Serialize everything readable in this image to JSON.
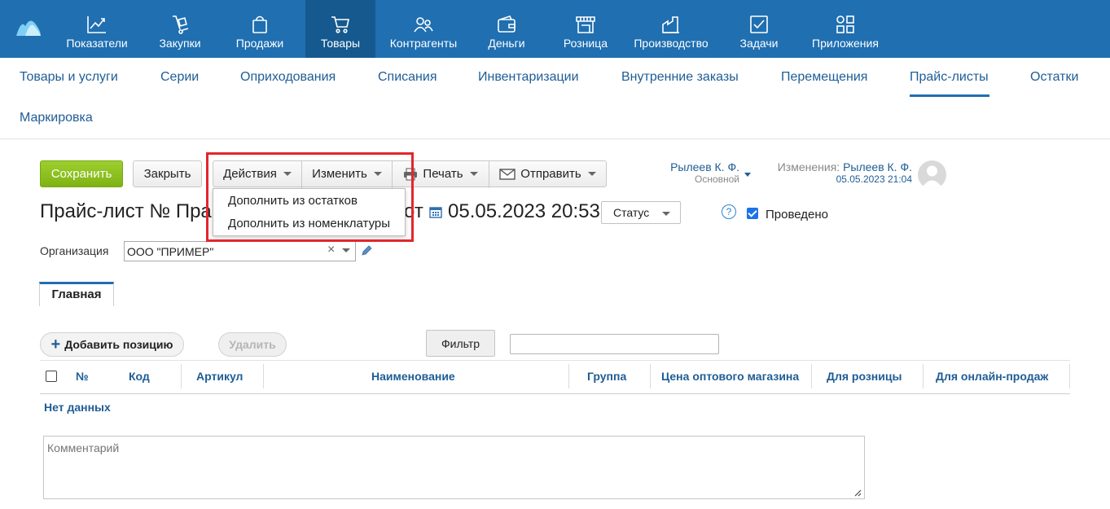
{
  "topnav": {
    "items": [
      {
        "label": "Показатели",
        "icon": "chart-line-icon"
      },
      {
        "label": "Закупки",
        "icon": "dolly-icon"
      },
      {
        "label": "Продажи",
        "icon": "bag-icon"
      },
      {
        "label": "Товары",
        "icon": "cart-icon",
        "active": true
      },
      {
        "label": "Контрагенты",
        "icon": "people-icon"
      },
      {
        "label": "Деньги",
        "icon": "wallet-icon"
      },
      {
        "label": "Розница",
        "icon": "shop-icon"
      },
      {
        "label": "Производство",
        "icon": "factory-icon"
      },
      {
        "label": "Задачи",
        "icon": "task-check-icon"
      },
      {
        "label": "Приложения",
        "icon": "apps-grid-icon"
      }
    ],
    "colors": {
      "background": "#1f6fb1",
      "active": "#15598f"
    }
  },
  "subnav": {
    "items": [
      "Товары и услуги",
      "Серии",
      "Оприходования",
      "Списания",
      "Инвентаризации",
      "Внутренние заказы",
      "Перемещения",
      "Прайс-листы",
      "Остатки",
      "Маркировка"
    ],
    "active": "Прайс-листы"
  },
  "toolbar": {
    "save": "Сохранить",
    "close": "Закрыть",
    "actions": "Действия",
    "change": "Изменить",
    "print": "Печать",
    "send": "Отправить"
  },
  "actions_menu": {
    "items": [
      "Дополнить из остатков",
      "Дополнить из номенклатуры"
    ]
  },
  "owner": {
    "name": "Рылеев К. Ф.",
    "group": "Основной"
  },
  "changes": {
    "label": "Изменения:",
    "name": "Рылеев К. Ф.",
    "date": "05.05.2023 21:04"
  },
  "doc": {
    "title_left": "Прайс-лист №  Прай",
    "title_from": "от",
    "date": "05.05.2023 20:53",
    "status_label": "Статус",
    "posted_label": "Проведено",
    "posted": true,
    "help": "?"
  },
  "organization": {
    "label": "Организация",
    "value": "ООО \"ПРИМЕР\""
  },
  "tabs": [
    "Главная"
  ],
  "positions": {
    "add": "Добавить позицию",
    "delete": "Удалить",
    "filter": "Фильтр",
    "filter_value": ""
  },
  "table": {
    "columns": [
      "№",
      "Код",
      "Артикул",
      "Наименование",
      "Группа",
      "Цена оптового магазина",
      "Для розницы",
      "Для онлайн-продаж"
    ],
    "empty_text": "Нет данных"
  },
  "comment": {
    "placeholder": "Комментарий"
  },
  "highlight_color": "#e3262d"
}
